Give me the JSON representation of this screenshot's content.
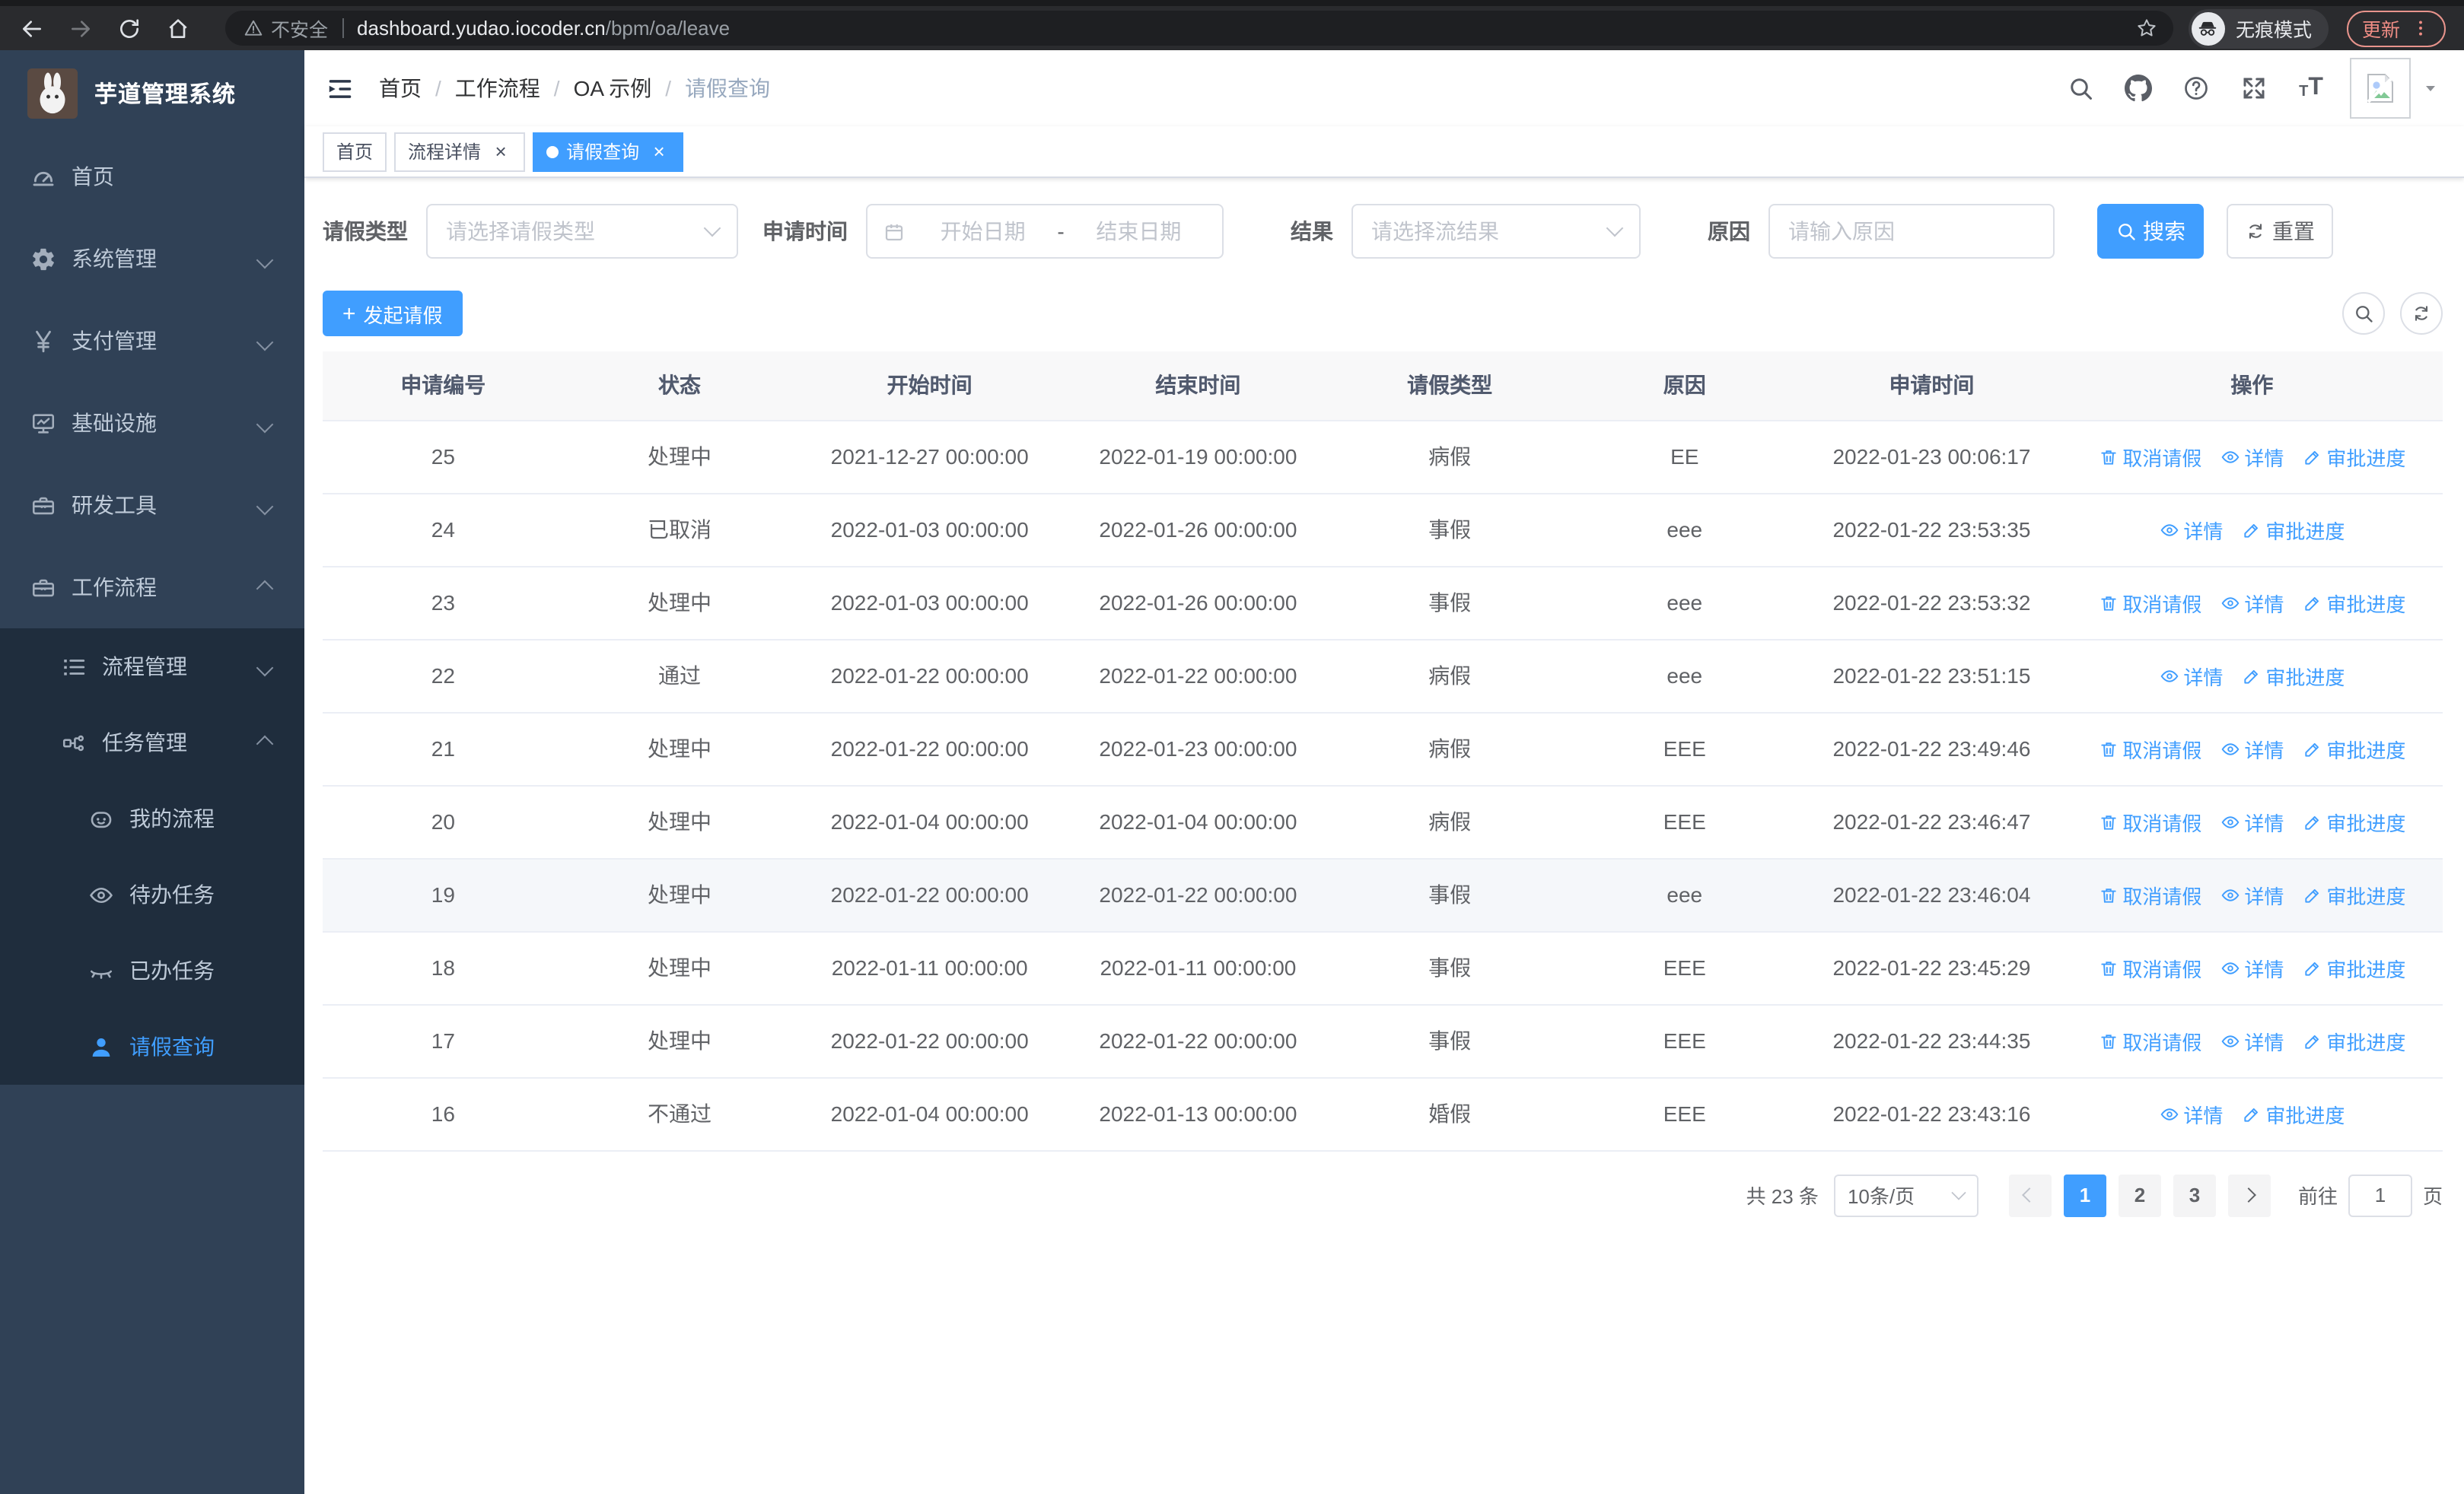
{
  "browser": {
    "security_label": "不安全",
    "url_host": "dashboard.yudao.iocoder.cn",
    "url_path": "/bpm/oa/leave",
    "incognito_label": "无痕模式",
    "update_label": "更新"
  },
  "sidebar": {
    "title": "芋道管理系统",
    "menu": [
      {
        "label": "首页",
        "icon": "dashboard",
        "arrow": ""
      },
      {
        "label": "系统管理",
        "icon": "gear",
        "arrow": "down"
      },
      {
        "label": "支付管理",
        "icon": "yen",
        "arrow": "down"
      },
      {
        "label": "基础设施",
        "icon": "monitor",
        "arrow": "down"
      },
      {
        "label": "研发工具",
        "icon": "toolbox",
        "arrow": "down"
      },
      {
        "label": "工作流程",
        "icon": "toolbox",
        "arrow": "up"
      }
    ],
    "submenu": [
      {
        "label": "流程管理",
        "icon": "listtree",
        "arrow": "down"
      },
      {
        "label": "任务管理",
        "icon": "tasktree",
        "arrow": "up"
      }
    ],
    "submenu_children": [
      {
        "label": "我的流程",
        "icon": "face",
        "active": false
      },
      {
        "label": "待办任务",
        "icon": "eyeopen",
        "active": false
      },
      {
        "label": "已办任务",
        "icon": "eyeclose",
        "active": false
      },
      {
        "label": "请假查询",
        "icon": "user",
        "active": true
      }
    ]
  },
  "header": {
    "breadcrumb": [
      "首页",
      "工作流程",
      "OA 示例",
      "请假查询"
    ],
    "icons": [
      "search",
      "github",
      "question",
      "fullscreen",
      "fontsize"
    ]
  },
  "tabs": [
    {
      "label": "首页",
      "closable": false,
      "active": false
    },
    {
      "label": "流程详情",
      "closable": true,
      "active": false
    },
    {
      "label": "请假查询",
      "closable": true,
      "active": true
    }
  ],
  "filters": {
    "leave_type_label": "请假类型",
    "leave_type_placeholder": "请选择请假类型",
    "apply_time_label": "申请时间",
    "date_start_placeholder": "开始日期",
    "date_separator": "-",
    "date_end_placeholder": "结束日期",
    "result_label": "结果",
    "result_placeholder": "请选择流结果",
    "reason_label": "原因",
    "reason_placeholder": "请输入原因",
    "search_label": "搜索",
    "reset_label": "重置"
  },
  "toolbar": {
    "create_label": "发起请假"
  },
  "table": {
    "columns": [
      "申请编号",
      "状态",
      "开始时间",
      "结束时间",
      "请假类型",
      "原因",
      "申请时间",
      "操作"
    ],
    "actions": {
      "cancel": {
        "label": "取消请假",
        "icon": "trash-icon"
      },
      "detail": {
        "label": "详情",
        "icon": "eye-icon"
      },
      "progress": {
        "label": "审批进度",
        "icon": "pen-icon"
      }
    },
    "rows": [
      {
        "id": "25",
        "status": "处理中",
        "start": "2021-12-27 00:00:00",
        "end": "2022-01-19 00:00:00",
        "type": "病假",
        "reason": "EE",
        "apply": "2022-01-23 00:06:17",
        "actions": [
          "cancel",
          "detail",
          "progress"
        ],
        "highlight": false
      },
      {
        "id": "24",
        "status": "已取消",
        "start": "2022-01-03 00:00:00",
        "end": "2022-01-26 00:00:00",
        "type": "事假",
        "reason": "eee",
        "apply": "2022-01-22 23:53:35",
        "actions": [
          "detail",
          "progress"
        ],
        "highlight": false
      },
      {
        "id": "23",
        "status": "处理中",
        "start": "2022-01-03 00:00:00",
        "end": "2022-01-26 00:00:00",
        "type": "事假",
        "reason": "eee",
        "apply": "2022-01-22 23:53:32",
        "actions": [
          "cancel",
          "detail",
          "progress"
        ],
        "highlight": false
      },
      {
        "id": "22",
        "status": "通过",
        "start": "2022-01-22 00:00:00",
        "end": "2022-01-22 00:00:00",
        "type": "病假",
        "reason": "eee",
        "apply": "2022-01-22 23:51:15",
        "actions": [
          "detail",
          "progress"
        ],
        "highlight": false
      },
      {
        "id": "21",
        "status": "处理中",
        "start": "2022-01-22 00:00:00",
        "end": "2022-01-23 00:00:00",
        "type": "病假",
        "reason": "EEE",
        "apply": "2022-01-22 23:49:46",
        "actions": [
          "cancel",
          "detail",
          "progress"
        ],
        "highlight": false
      },
      {
        "id": "20",
        "status": "处理中",
        "start": "2022-01-04 00:00:00",
        "end": "2022-01-04 00:00:00",
        "type": "病假",
        "reason": "EEE",
        "apply": "2022-01-22 23:46:47",
        "actions": [
          "cancel",
          "detail",
          "progress"
        ],
        "highlight": false
      },
      {
        "id": "19",
        "status": "处理中",
        "start": "2022-01-22 00:00:00",
        "end": "2022-01-22 00:00:00",
        "type": "事假",
        "reason": "eee",
        "apply": "2022-01-22 23:46:04",
        "actions": [
          "cancel",
          "detail",
          "progress"
        ],
        "highlight": true
      },
      {
        "id": "18",
        "status": "处理中",
        "start": "2022-01-11 00:00:00",
        "end": "2022-01-11 00:00:00",
        "type": "事假",
        "reason": "EEE",
        "apply": "2022-01-22 23:45:29",
        "actions": [
          "cancel",
          "detail",
          "progress"
        ],
        "highlight": false
      },
      {
        "id": "17",
        "status": "处理中",
        "start": "2022-01-22 00:00:00",
        "end": "2022-01-22 00:00:00",
        "type": "事假",
        "reason": "EEE",
        "apply": "2022-01-22 23:44:35",
        "actions": [
          "cancel",
          "detail",
          "progress"
        ],
        "highlight": false
      },
      {
        "id": "16",
        "status": "不通过",
        "start": "2022-01-04 00:00:00",
        "end": "2022-01-13 00:00:00",
        "type": "婚假",
        "reason": "EEE",
        "apply": "2022-01-22 23:43:16",
        "actions": [
          "detail",
          "progress"
        ],
        "highlight": false
      }
    ]
  },
  "pagination": {
    "total_label": "共 23 条",
    "page_size": "10条/页",
    "pages": [
      "1",
      "2",
      "3"
    ],
    "active_page": "1",
    "prev_icon": "chevron-left-icon",
    "next_icon": "chevron-right-icon",
    "goto_label": "前往",
    "goto_value": "1",
    "page_suffix": "页"
  },
  "colors": {
    "accent": "#409eff",
    "sidebar_bg": "#304156",
    "submenu_bg": "#1f2d3d"
  }
}
